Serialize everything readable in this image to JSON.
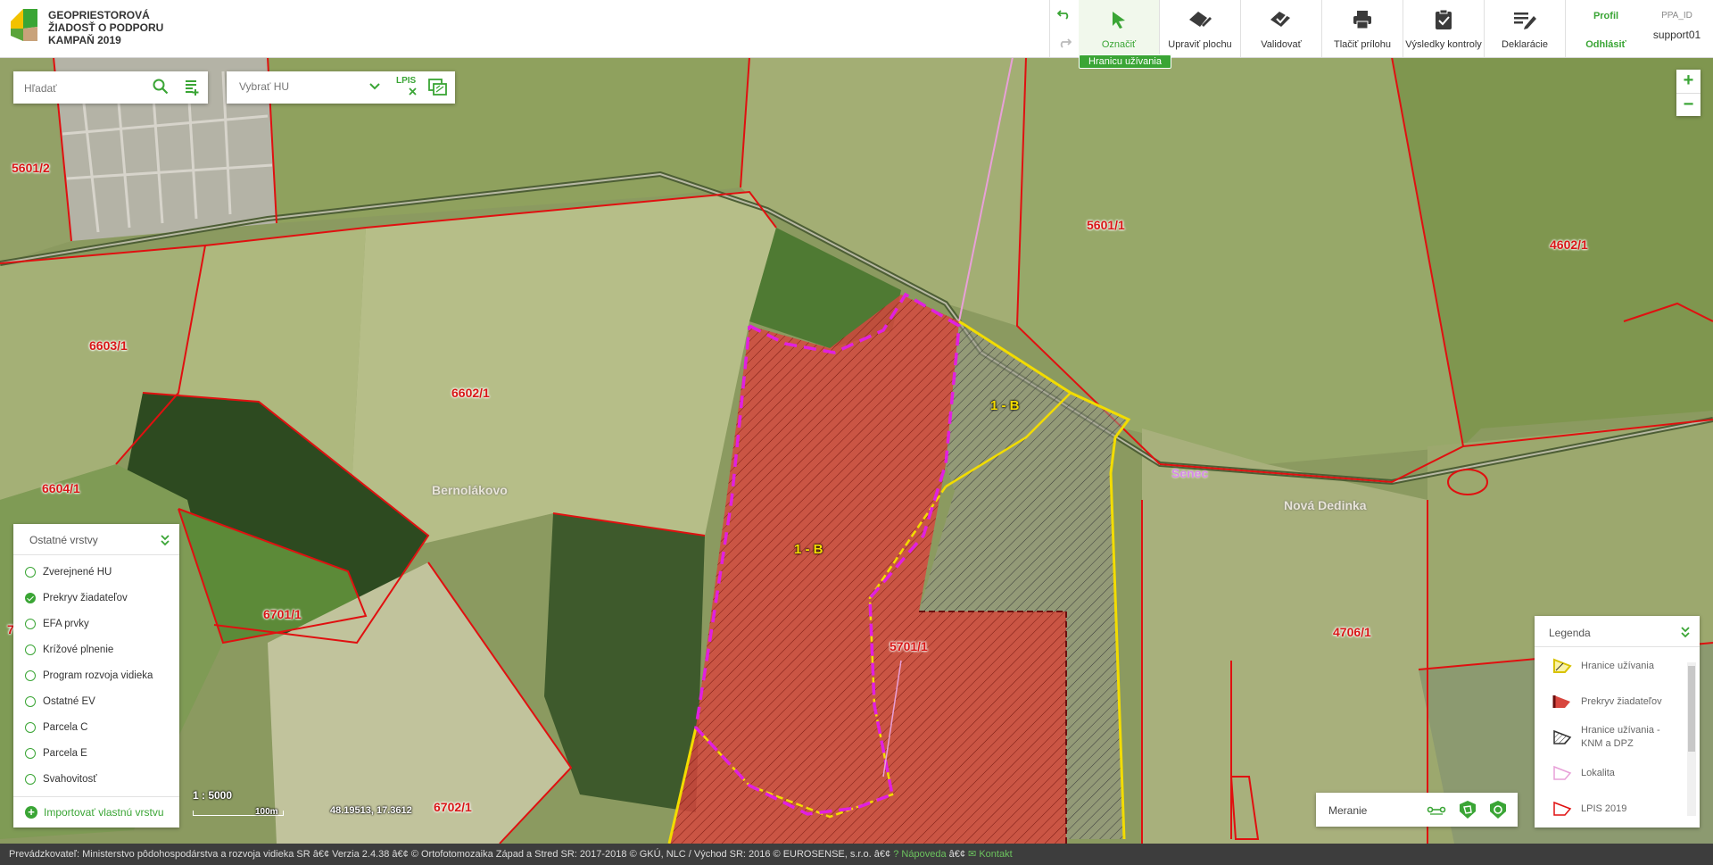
{
  "brand": {
    "line1": "GEOPRIESTOROVÁ",
    "line2": "ŽIADOSŤ O PODPORU",
    "line3": "KAMPAŇ 2019"
  },
  "toolbar": {
    "tools": [
      {
        "label": "Označiť",
        "icon": "cursor-icon",
        "active": true
      },
      {
        "label": "Upraviť plochu",
        "icon": "edit-area-icon"
      },
      {
        "label": "Validovať",
        "icon": "validate-icon"
      },
      {
        "label": "Tlačiť prílohu",
        "icon": "printer-icon"
      },
      {
        "label": "Výsledky kontroly",
        "icon": "clipboard-check-icon"
      },
      {
        "label": "Deklarácie",
        "icon": "declarations-icon"
      }
    ],
    "tooltip": "Hranicu užívania",
    "profile_label": "Profil",
    "logout_label": "Odhlásiť",
    "user_id_label": "PPA_ID",
    "username": "support01"
  },
  "search": {
    "placeholder": "Hľadať",
    "hu_placeholder": "Vybrať HU",
    "lpis_label": "LPIS"
  },
  "layers": {
    "title": "Ostatné vrstvy",
    "items": [
      {
        "label": "Zverejnené HU",
        "checked": false
      },
      {
        "label": "Prekryv žiadateľov",
        "checked": true
      },
      {
        "label": "EFA prvky",
        "checked": false
      },
      {
        "label": "Krížové plnenie",
        "checked": false
      },
      {
        "label": "Program rozvoja vidieka",
        "checked": false
      },
      {
        "label": "Ostatné EV",
        "checked": false
      },
      {
        "label": "Parcela C",
        "checked": false
      },
      {
        "label": "Parcela E",
        "checked": false
      },
      {
        "label": "Svahovitosť",
        "checked": false
      }
    ],
    "import_label": "Importovať vlastnú vrstvu"
  },
  "legend": {
    "title": "Legenda",
    "items": [
      {
        "line1": "Hranice užívania",
        "line2": ""
      },
      {
        "line1": "Prekryv žiadateľov",
        "line2": ""
      },
      {
        "line1": "Hranice užívania -",
        "line2": "KNM a DPZ"
      },
      {
        "line1": "Lokalita",
        "line2": ""
      },
      {
        "line1": "LPIS 2019",
        "line2": ""
      }
    ]
  },
  "measure": {
    "label": "Meranie"
  },
  "map": {
    "scale_ratio": "1 : 5000",
    "scale_bar_label": "100m",
    "coordinates": "48.19513, 17.3612",
    "parcel_labels": [
      "5601/2",
      "5601/1",
      "4602/1",
      "6603/1",
      "6602/1",
      "6604/1",
      "6701/1",
      "5701/1",
      "4706/1",
      "6702/1",
      "7"
    ],
    "town_labels": [
      "Bernolákovo",
      "Senec",
      "Nová Dedinka"
    ],
    "hu_labels": [
      "1 - B",
      "1 - B"
    ]
  },
  "statusbar": {
    "operator": "Prevádzkovateľ: Ministerstvo pôdohospodárstva a rozvoja vidieka SR",
    "sep": "â€¢",
    "version": "Verzia 2.4.38",
    "ortho": "© Ortofotomozaika Západ a Stred SR: 2017-2018 © GKÚ, NLC / Východ SR: 2016 © EUROSENSE, s.r.o.",
    "help_label": "Nápoveda",
    "contact_label": "Kontakt"
  },
  "colors": {
    "accent": "#3aa535",
    "parcel_border": "#e01010",
    "hu_border": "#f2dc00",
    "overlap_border": "#e020e0",
    "overlap_fill": "#d9473e"
  }
}
